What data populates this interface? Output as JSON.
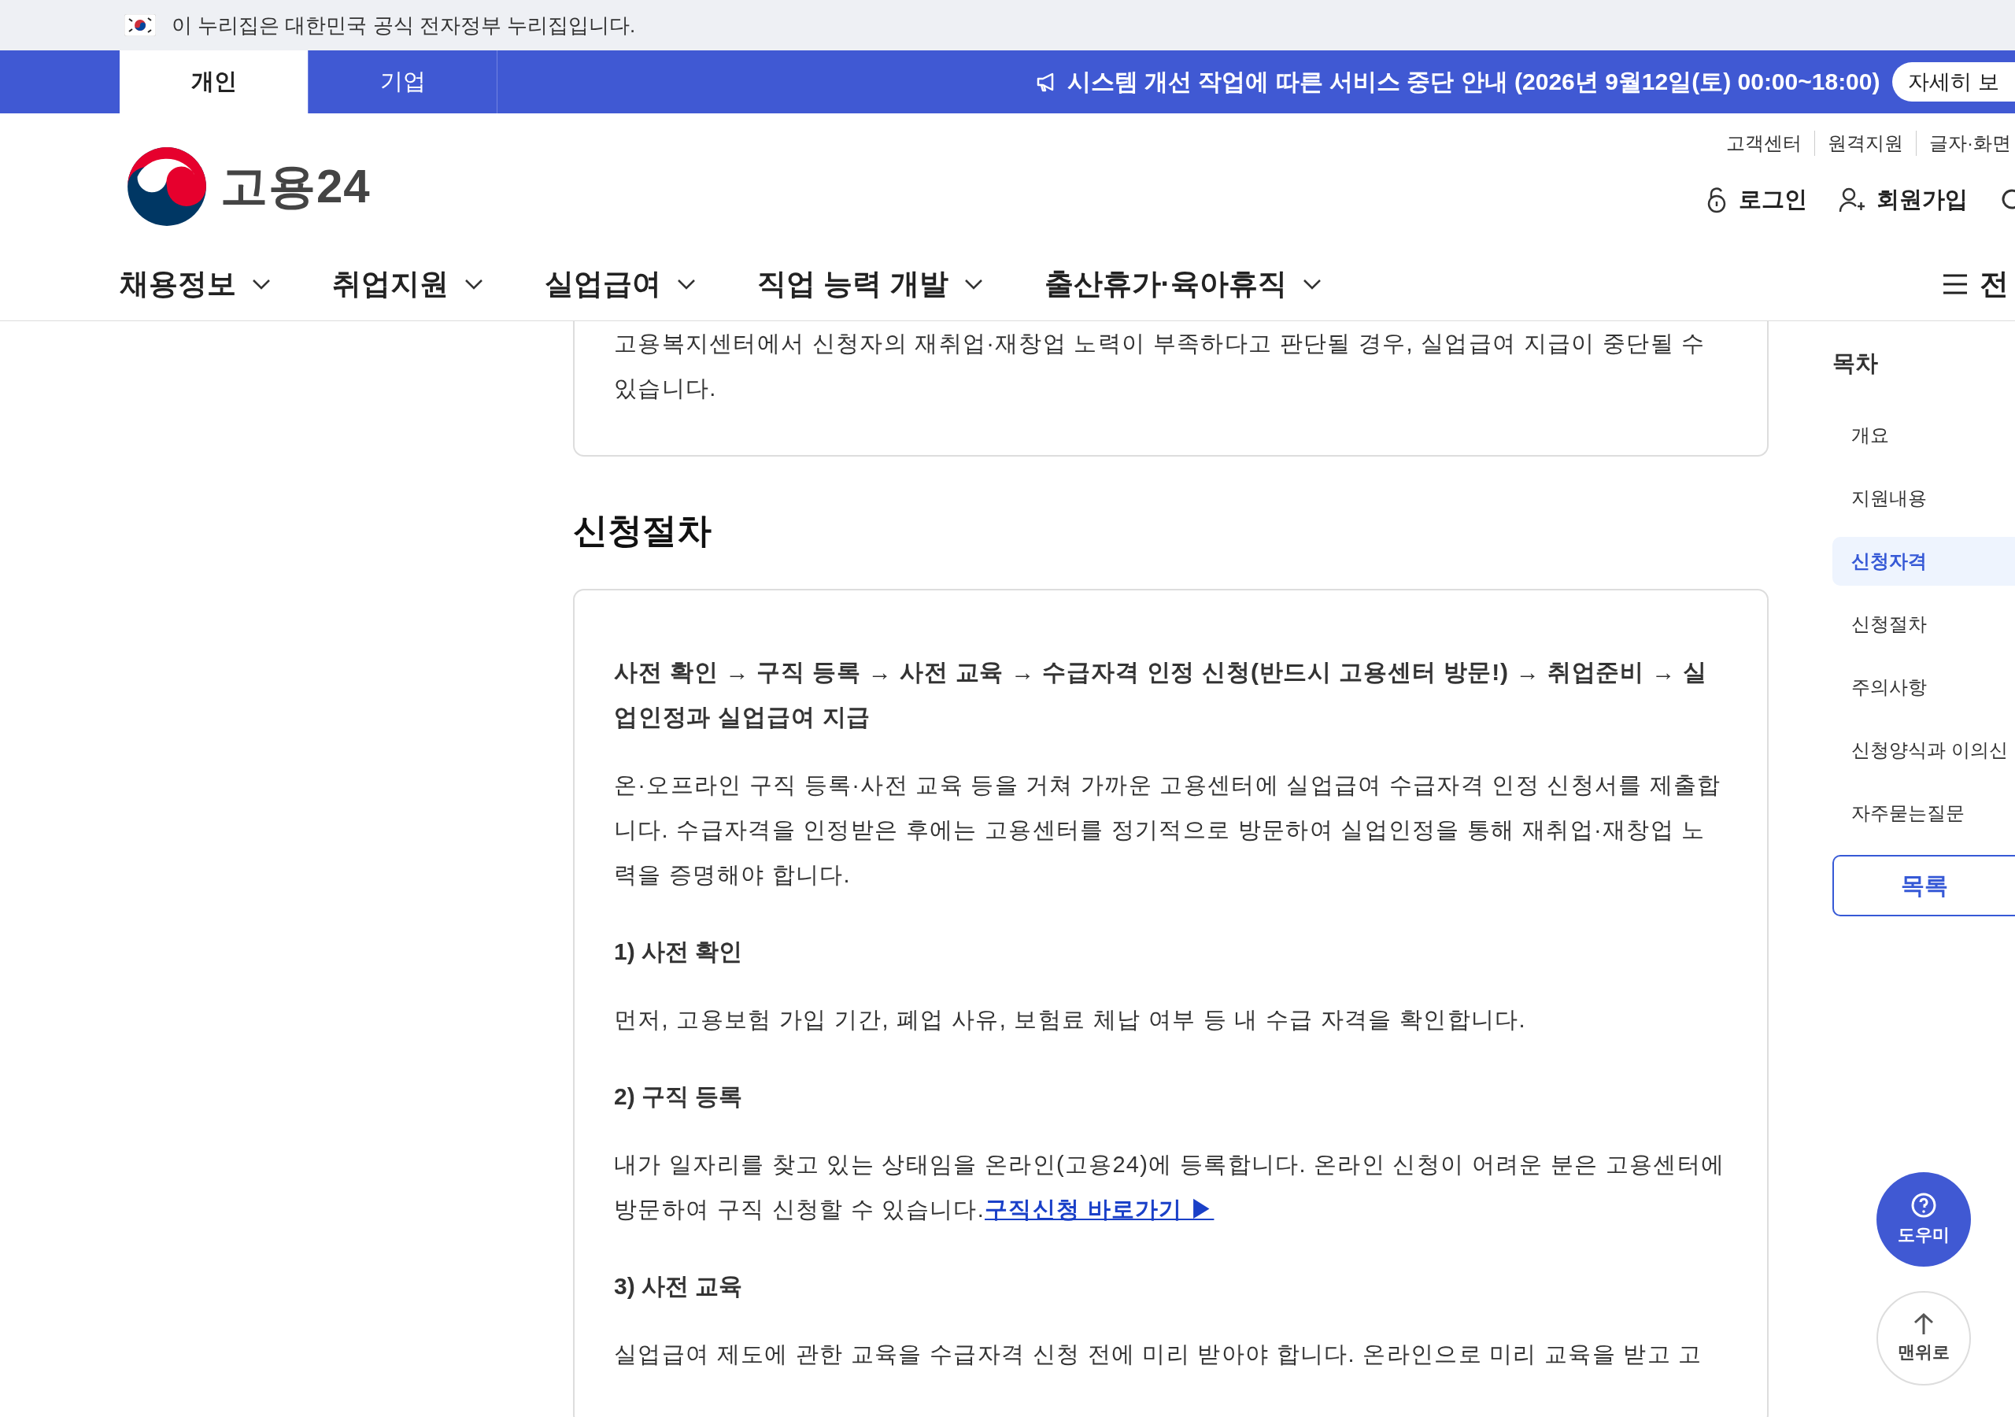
{
  "gov_banner": {
    "text": "이 누리집은 대한민국 공식 전자정부 누리집입니다."
  },
  "audience_tabs": [
    {
      "label": "개인",
      "selected": true
    },
    {
      "label": "기업",
      "selected": false
    }
  ],
  "notice": {
    "text": "시스템 개선 작업에 따른 서비스 중단 안내 (2026년 9월12일(토) 00:00~18:00)",
    "button": "자세히 보"
  },
  "logo": {
    "text": "고용24"
  },
  "utility_links": [
    "고객센터",
    "원격지원",
    "글자·화면"
  ],
  "account_links": [
    {
      "kind": "login",
      "label": "로그인"
    },
    {
      "kind": "signup",
      "label": "회원가입"
    }
  ],
  "main_nav": [
    "채용정보",
    "취업지원",
    "실업급여",
    "직업 능력 개발",
    "출산휴가·육아휴직"
  ],
  "all_menu": "전",
  "content": {
    "prev_card_text": "고용복지센터에서 신청자의 재취업·재창업 노력이 부족하다고 판단될 경우, 실업급여 지급이 중단될 수 있습니다.",
    "section_title": "신청절차",
    "blocks": [
      {
        "kind": "summary",
        "text": "사전 확인 → 구직 등록 → 사전 교육 → 수급자격 인정 신청(반드시 고용센터 방문!) → 취업준비 → 실업인정과 실업급여 지급"
      },
      {
        "kind": "paragraph",
        "text": "온·오프라인 구직 등록·사전 교육 등을 거쳐 가까운 고용센터에 실업급여 수급자격 인정 신청서를 제출합니다. 수급자격을 인정받은 후에는 고용센터를 정기적으로 방문하여 실업인정을 통해 재취업·재창업 노력을 증명해야 합니다."
      },
      {
        "kind": "subheading",
        "text": "1) 사전 확인"
      },
      {
        "kind": "paragraph",
        "text": "먼저, 고용보험 가입 기간, 폐업 사유, 보험료 체납 여부 등 내 수급 자격을 확인합니다."
      },
      {
        "kind": "subheading",
        "text": "2) 구직 등록"
      },
      {
        "kind": "paragraph",
        "text": "내가 일자리를 찾고 있는 상태임을 온라인(고용24)에 등록합니다. 온라인 신청이 어려운 분은 고용센터에 방문하여 구직 신청할 수 있습니다.",
        "link": "구직신청 바로가기 ▶"
      },
      {
        "kind": "subheading",
        "text": "3) 사전 교육"
      },
      {
        "kind": "paragraph",
        "text": "실업급여 제도에 관한 교육을 수급자격 신청 전에 미리 받아야 합니다. 온라인으로 미리 교육을 받고 고"
      }
    ]
  },
  "toc": {
    "title": "목차",
    "items": [
      {
        "label": "개요",
        "selected": false
      },
      {
        "label": "지원내용",
        "selected": false
      },
      {
        "label": "신청자격",
        "selected": true
      },
      {
        "label": "신청절차",
        "selected": false
      },
      {
        "label": "주의사항",
        "selected": false
      },
      {
        "label": "신청양식과 이의신",
        "selected": false
      },
      {
        "label": "자주묻는질문",
        "selected": false
      }
    ],
    "button": "목록"
  },
  "floating": [
    {
      "kind": "help",
      "label": "도우미"
    },
    {
      "kind": "top",
      "label": "맨위로"
    }
  ]
}
